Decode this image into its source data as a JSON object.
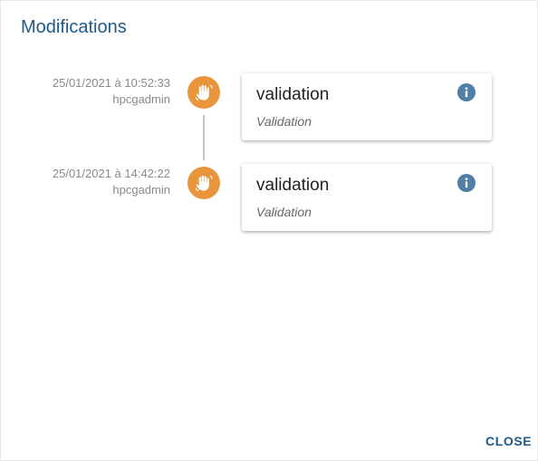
{
  "dialog": {
    "title": "Modifications",
    "close_label": "CLOSE"
  },
  "colors": {
    "accent": "#1e5a8a",
    "avatar": "#e8953c",
    "info": "#4f7ea8"
  },
  "timeline": [
    {
      "timestamp": "25/01/2021 à 10:52:33",
      "user": "hpcgadmin",
      "icon": "hand-wave-icon",
      "title": "validation",
      "subtitle": "Validation"
    },
    {
      "timestamp": "25/01/2021 à 14:42:22",
      "user": "hpcgadmin",
      "icon": "hand-wave-icon",
      "title": "validation",
      "subtitle": "Validation"
    }
  ]
}
